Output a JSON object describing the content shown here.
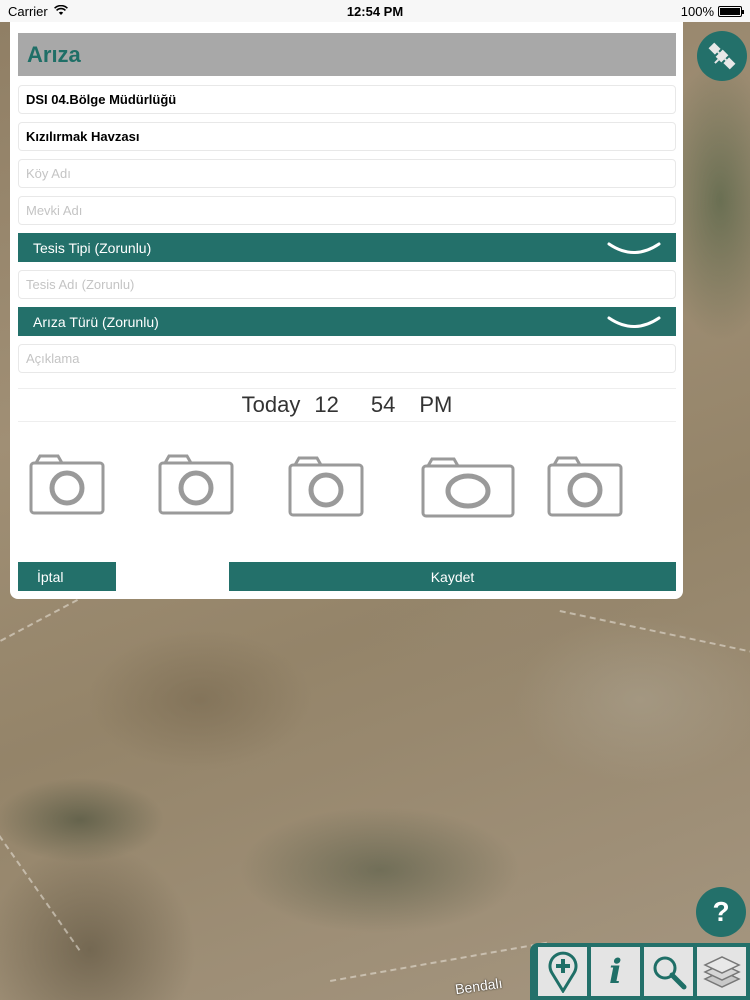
{
  "status_bar": {
    "carrier": "Carrier",
    "time": "12:54 PM",
    "battery": "100%",
    "battery_level": 1.0
  },
  "form": {
    "title": "Arıza",
    "region_value": "DSI 04.Bölge Müdürlüğü",
    "basin_value": "Kızılırmak Havzası",
    "village_placeholder": "Köy Adı",
    "location_placeholder": "Mevki Adı",
    "facility_type_label": "Tesis Tipi (Zorunlu)",
    "facility_name_placeholder": "Tesis Adı (Zorunlu)",
    "fault_type_label": "Arıza Türü (Zorunlu)",
    "description_placeholder": "Açıklama",
    "picker": {
      "day": "Today",
      "hour": "12",
      "minute": "54",
      "period": "PM"
    },
    "cancel_label": "İptal",
    "save_label": "Kaydet"
  },
  "map": {
    "place_label": "Bendalı"
  },
  "floating": {
    "help_label": "?",
    "satellite_icon": "satellite-icon",
    "toolbar": [
      {
        "icon": "add-location-pin-icon"
      },
      {
        "icon": "info-icon",
        "glyph": "i"
      },
      {
        "icon": "search-icon"
      },
      {
        "icon": "layers-icon"
      }
    ]
  },
  "colors": {
    "accent": "#23706a",
    "title_text": "#1f6f67",
    "header_bar": "#a8a8a8"
  }
}
